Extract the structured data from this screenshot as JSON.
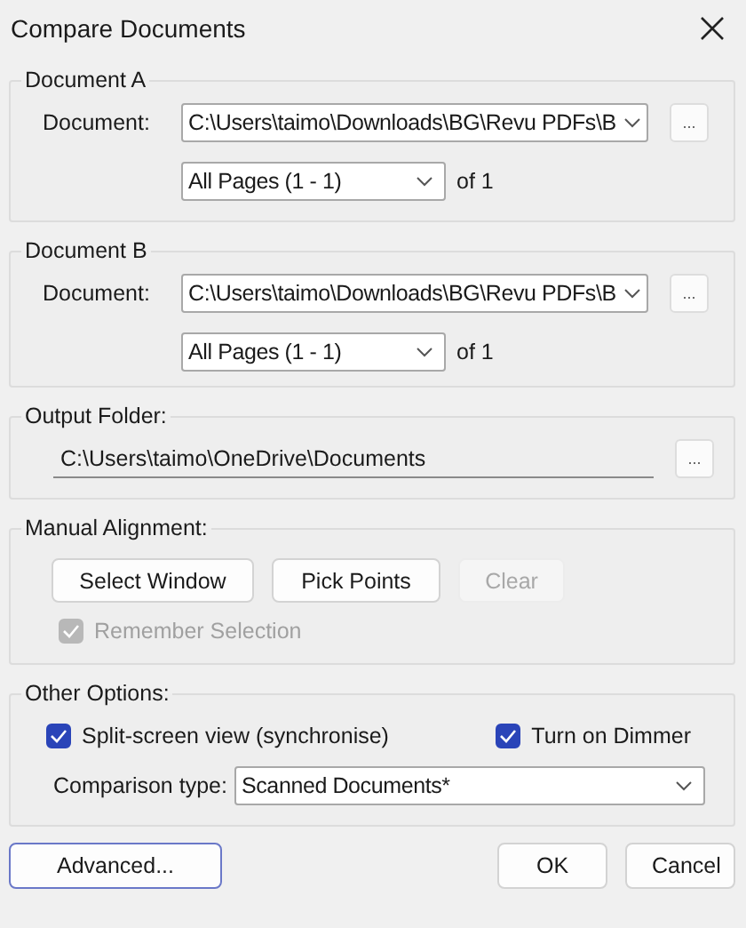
{
  "window": {
    "title": "Compare Documents"
  },
  "documents": [
    {
      "legend": "Document A",
      "label": "Document:",
      "path": "C:\\Users\\taimo\\Downloads\\BG\\Revu PDFs\\B",
      "browse": "...",
      "pages": "All Pages (1 - 1)",
      "of": "of  1"
    },
    {
      "legend": "Document B",
      "label": "Document:",
      "path": "C:\\Users\\taimo\\Downloads\\BG\\Revu PDFs\\B",
      "browse": "...",
      "pages": "All Pages (1 - 1)",
      "of": "of  1"
    }
  ],
  "output_folder": {
    "legend": "Output Folder:",
    "path": "C:\\Users\\taimo\\OneDrive\\Documents",
    "browse": "..."
  },
  "manual_alignment": {
    "legend": "Manual Alignment:",
    "buttons": [
      {
        "label": "Select Window",
        "disabled": false
      },
      {
        "label": "Pick Points",
        "disabled": false
      },
      {
        "label": "Clear",
        "disabled": true
      }
    ],
    "remember": {
      "label": "Remember Selection",
      "checked": true,
      "disabled": true
    }
  },
  "other_options": {
    "legend": "Other Options:",
    "checkboxes": [
      {
        "label": "Split-screen view (synchronise)",
        "checked": true,
        "disabled": false
      },
      {
        "label": "Turn on Dimmer",
        "checked": true,
        "disabled": false
      }
    ],
    "comparison_label": "Comparison type:",
    "comparison_value": "Scanned Documents*"
  },
  "footer": [
    {
      "label": "Advanced...",
      "focused": true
    },
    {
      "label": "OK",
      "focused": false
    },
    {
      "label": "Cancel",
      "focused": false
    }
  ]
}
